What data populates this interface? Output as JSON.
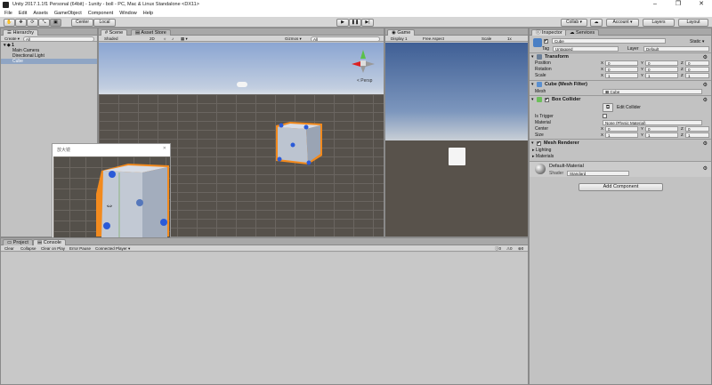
{
  "window": {
    "title": "Unity 2017.1.1f1 Personal (64bit) - 1unity - boll - PC, Mac & Linux Standalone <DX11>",
    "controls": [
      "–",
      "❐",
      "✕"
    ]
  },
  "menu": [
    "File",
    "Edit",
    "Assets",
    "GameObject",
    "Component",
    "Window",
    "Help"
  ],
  "toolbar": {
    "pivot_label": "Center",
    "space_label": "Local",
    "collab_label": "Collab ▾",
    "cloud_icon": "cloud-icon",
    "account_label": "Account ▾",
    "layers_label": "Layers",
    "layout_label": "Layout"
  },
  "hierarchy": {
    "tab": "Hierarchy",
    "create_label": "Create ▾",
    "search_placeholder": "All",
    "scene": "1",
    "items": [
      "Main Camera",
      "Directional Light",
      "Cube"
    ],
    "selected_index": 2
  },
  "scene": {
    "tab": "Scene",
    "asset_store_tab": "Asset Store",
    "shading": "Shaded",
    "mode_2d": "2D",
    "gizmos_label": "Gizmos ▾",
    "search_placeholder": "All",
    "persp_label": "< Persp"
  },
  "magnifier": {
    "title": "放大镜",
    "close": "✕"
  },
  "game": {
    "tab": "Game",
    "display": "Display 1",
    "aspect": "Free Aspect",
    "scale_label": "Scale",
    "scale_value": "1x"
  },
  "inspector": {
    "tab": "Inspector",
    "services_tab": "Services",
    "object_name": "Cube",
    "static_label": "Static ▾",
    "tag_label": "Tag",
    "tag_value": "Untagged",
    "layer_label": "Layer",
    "layer_value": "Default",
    "transform": {
      "title": "Transform",
      "position_label": "Position",
      "rotation_label": "Rotation",
      "scale_label": "Scale",
      "position": [
        "0",
        "0",
        "0"
      ],
      "rotation": [
        "0",
        "0",
        "0"
      ],
      "scale": [
        "1",
        "1",
        "1"
      ]
    },
    "mesh_filter": {
      "title": "Cube (Mesh Filter)",
      "mesh_label": "Mesh",
      "mesh_value": "Cube"
    },
    "box_collider": {
      "title": "Box Collider",
      "edit_label": "Edit Collider",
      "is_trigger_label": "Is Trigger",
      "material_label": "Material",
      "material_value": "None (Physic Material)",
      "center_label": "Center",
      "size_label": "Size",
      "center": [
        "0",
        "0",
        "0"
      ],
      "size": [
        "1",
        "1",
        "1"
      ]
    },
    "mesh_renderer": {
      "title": "Mesh Renderer",
      "lighting": "Lighting",
      "materials": "Materials"
    },
    "material": {
      "name": "Default-Material",
      "shader_label": "Shader",
      "shader_value": "Standard"
    },
    "add_component": "Add Component"
  },
  "console": {
    "project_tab": "Project",
    "console_tab": "Console",
    "buttons": [
      "Clear",
      "Collapse",
      "Clear on Play",
      "Error Pause",
      "Connected Player ▾"
    ],
    "counts": [
      "0",
      "0",
      "0"
    ]
  },
  "colors": {
    "selection": "#8fa5c4",
    "accent_orange": "#f28a1e",
    "handle_blue": "#2a5ad8"
  }
}
